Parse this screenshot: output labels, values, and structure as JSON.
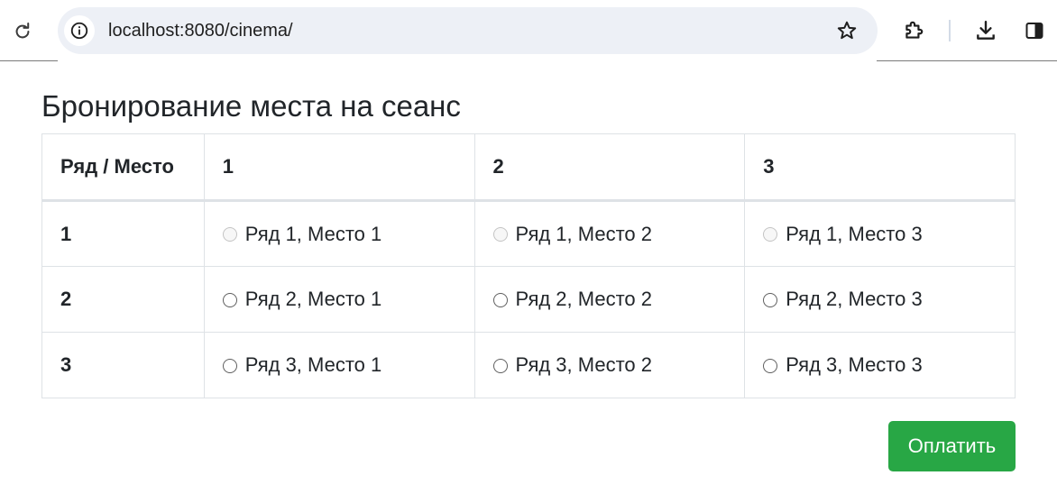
{
  "browser": {
    "url": "localhost:8080/cinema/"
  },
  "page": {
    "title": "Бронирование места на сеанс"
  },
  "table": {
    "corner_header": "Ряд / Место",
    "columns": [
      "1",
      "2",
      "3"
    ],
    "rows": [
      {
        "label": "1",
        "seats": [
          {
            "label": "Ряд 1, Место 1",
            "disabled": true
          },
          {
            "label": "Ряд 1, Место 2",
            "disabled": true
          },
          {
            "label": "Ряд 1, Место 3",
            "disabled": true
          }
        ]
      },
      {
        "label": "2",
        "seats": [
          {
            "label": "Ряд 2, Место 1",
            "disabled": false
          },
          {
            "label": "Ряд 2, Место 2",
            "disabled": false
          },
          {
            "label": "Ряд 2, Место 3",
            "disabled": false
          }
        ]
      },
      {
        "label": "3",
        "seats": [
          {
            "label": "Ряд 3, Место 1",
            "disabled": false
          },
          {
            "label": "Ряд 3, Место 2",
            "disabled": false
          },
          {
            "label": "Ряд 3, Место 3",
            "disabled": false
          }
        ]
      }
    ]
  },
  "actions": {
    "pay_label": "Оплатить"
  },
  "colors": {
    "pay_button": "#28a745",
    "table_border": "#dee2e6",
    "omnibox_bg": "#edf0f6"
  },
  "icons": {
    "reload": "reload-icon",
    "site_info": "info-icon",
    "bookmark": "star-icon",
    "extensions": "puzzle-icon",
    "downloads": "download-icon",
    "side_panel": "side-panel-icon"
  }
}
